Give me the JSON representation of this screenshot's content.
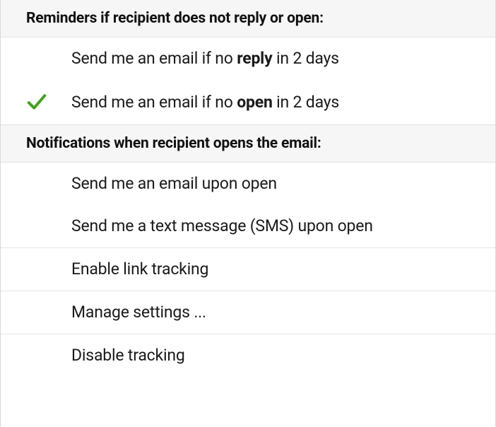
{
  "sections": {
    "reminders": {
      "header": "Reminders if recipient does not reply or open:",
      "items": {
        "no_reply": {
          "prefix": "Send me an email if no ",
          "bold": "reply",
          "suffix": " in 2 days",
          "checked": false
        },
        "no_open": {
          "prefix": "Send me an email if no ",
          "bold": "open",
          "suffix": " in 2 days",
          "checked": true
        }
      }
    },
    "notifications": {
      "header": "Notifications when recipient opens the email:",
      "items": {
        "email_open": {
          "label": "Send me an email upon open"
        },
        "sms_open": {
          "label": "Send me a text message (SMS) upon open"
        }
      }
    },
    "footer": {
      "link_tracking": "Enable link tracking",
      "manage_settings": "Manage settings ...",
      "disable_tracking": "Disable tracking"
    }
  },
  "colors": {
    "check": "#3fa31c"
  }
}
